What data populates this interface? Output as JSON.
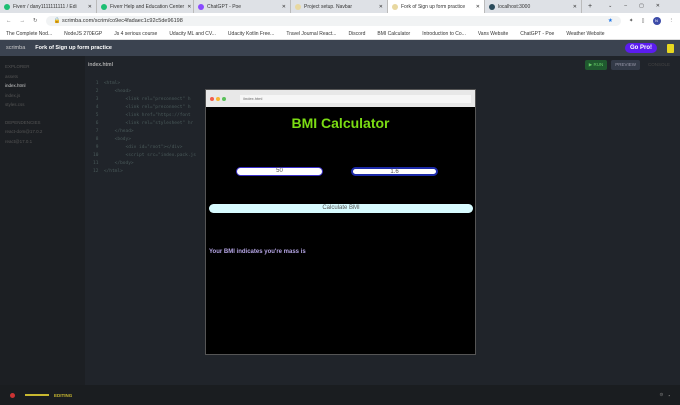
{
  "browser": {
    "tabs": [
      {
        "label": "Fiverr / dany1111111111 / Edi",
        "color": "#1dbf73"
      },
      {
        "label": "Fiverr Help and Education Center",
        "color": "#1dbf73"
      },
      {
        "label": "ChatGPT - Poe",
        "color": "#8a4bff"
      },
      {
        "label": "Project setup. Navbar",
        "color": "#e8d8a0"
      },
      {
        "label": "Fork of Sign up form practice",
        "color": "#e8d8a0"
      },
      {
        "label": "localhost:3000",
        "color": "#2a4a5a"
      }
    ],
    "url": "scrimba.com/scrim/co9ec4fadaec1c92c5de96198",
    "bookmarks": [
      "The Complete Nod...",
      "NodeJS 270EGP",
      "Js 4 serious course",
      "Udacity ML and CV...",
      "Udacity Kotlin Free...",
      "Travel Journal React...",
      "Discord",
      "BMI Calculator",
      "Introduction to Co...",
      "Vans Website",
      "ChatGPT - Poe",
      "Weather Website"
    ]
  },
  "header": {
    "brand": "scrimba",
    "title": "Fork of Sign up form practice",
    "go_pro": "Go Pro!"
  },
  "sidebar": {
    "explorer": "EXPLORER",
    "files": [
      "assets",
      "index.html",
      "index.js",
      "styles.css"
    ],
    "deps_title": "DEPENDENCIES",
    "deps": [
      "react-dom@17.0.2",
      "react@17.0.1"
    ]
  },
  "editor": {
    "filename": "index.html",
    "run": "▶ RUN",
    "preview": "PREVIEW",
    "console": "CONSOLE",
    "code": " 1  <html>\n 2      <head>\n 3          <link rel=\"preconnect\" h\n 4          <link rel=\"preconnect\" h\n 5          <link href=\"https://font\n 6          <link rel=\"stylesheet\" hr\n 7      </head>\n 8      <body>\n 9          <div id=\"root\"></div>\n10          <script src=\"index.pack.js\n11      </body>\n12  </html>"
  },
  "preview": {
    "url": "/index.html",
    "title": "BMI Calculator",
    "weight": "50",
    "height": "1.6",
    "button": "Calculate BMI",
    "result": "Your BMI indicates you're mass is"
  },
  "footer": {
    "status": "EDITING"
  }
}
